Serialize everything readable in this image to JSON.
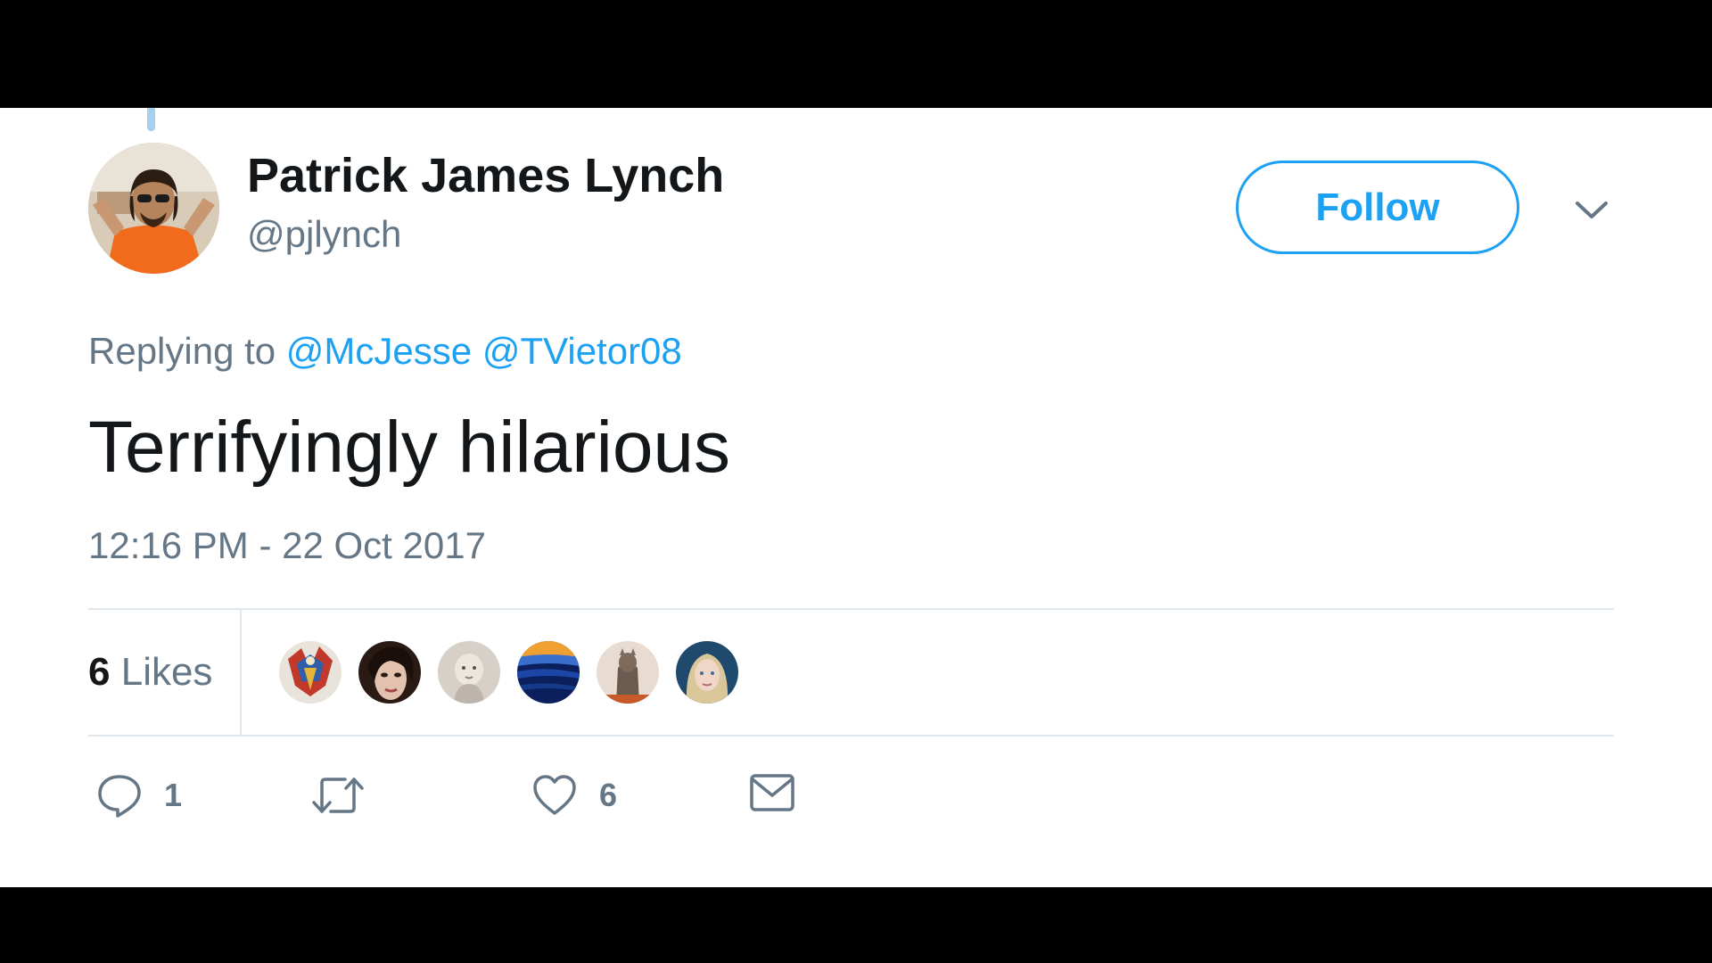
{
  "tweet": {
    "author": {
      "display_name": "Patrick James Lynch",
      "handle": "@pjlynch"
    },
    "follow_label": "Follow",
    "reply_context": {
      "prefix": "Replying to ",
      "mentions": [
        "@McJesse",
        "@TVietor08"
      ]
    },
    "text": "Terrifyingly hilarious",
    "timestamp": "12:16 PM - 22 Oct 2017",
    "likes": {
      "count": "6",
      "label": "Likes"
    },
    "actions": {
      "reply_count": "1",
      "like_count": "6"
    },
    "icons": {
      "caret": "chevron-down-icon",
      "reply": "reply-icon",
      "retweet": "retweet-icon",
      "like": "heart-icon",
      "dm": "envelope-icon"
    },
    "colors": {
      "accent": "#1da1f2",
      "secondary_text": "#657786",
      "primary_text": "#14171a",
      "divider": "#e1e8ed"
    }
  }
}
